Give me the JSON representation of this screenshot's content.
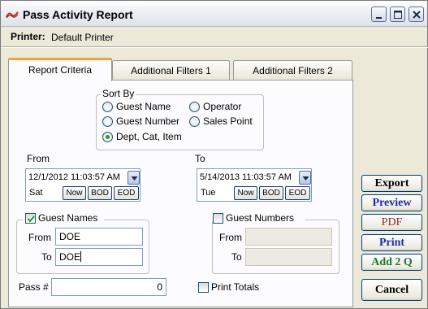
{
  "window": {
    "title": "Pass Activity Report",
    "icon": "app-logo-icon"
  },
  "printer": {
    "label": "Printer:",
    "value": "Default Printer"
  },
  "tabs": [
    {
      "label": "Report Criteria",
      "active": true
    },
    {
      "label": "Additional Filters 1",
      "active": false
    },
    {
      "label": "Additional Filters 2",
      "active": false
    }
  ],
  "sort_by": {
    "label": "Sort By",
    "options": [
      {
        "label": "Guest Name",
        "checked": false
      },
      {
        "label": "Operator",
        "checked": false
      },
      {
        "label": "Guest Number",
        "checked": false
      },
      {
        "label": "Sales Point",
        "checked": false
      },
      {
        "label": "Dept, Cat, Item",
        "checked": true
      }
    ]
  },
  "from": {
    "label": "From",
    "datetime": "12/1/2012 11:03:57 AM",
    "day": "Sat"
  },
  "to": {
    "label": "To",
    "datetime": "5/14/2013 11:03:57 AM",
    "day": "Tue"
  },
  "date_buttons": {
    "now": "Now",
    "bod": "BOD",
    "eod": "EOD"
  },
  "guest_names": {
    "label": "Guest Names",
    "checked": true,
    "from_label": "From",
    "from_value": "DOE",
    "to_label": "To",
    "to_value": "DOE"
  },
  "guest_numbers": {
    "label": "Guest Numbers",
    "checked": false,
    "from_label": "From",
    "from_value": "",
    "to_label": "To",
    "to_value": ""
  },
  "pass": {
    "label": "Pass #",
    "value": "0"
  },
  "print_totals": {
    "label": "Print Totals",
    "checked": false
  },
  "actions": {
    "export": "Export",
    "preview": "Preview",
    "pdf": "PDF",
    "print": "Print",
    "add2q": "Add 2 Q",
    "cancel": "Cancel"
  },
  "colors": {
    "active_tab_accent": "#f2a33a",
    "preview_text": "#1a2aa8",
    "pdf_text": "#8b2a24",
    "print_text": "#1a2aa8",
    "add2q_text": "#1f7a2a",
    "radio_dot": "#21a121"
  }
}
